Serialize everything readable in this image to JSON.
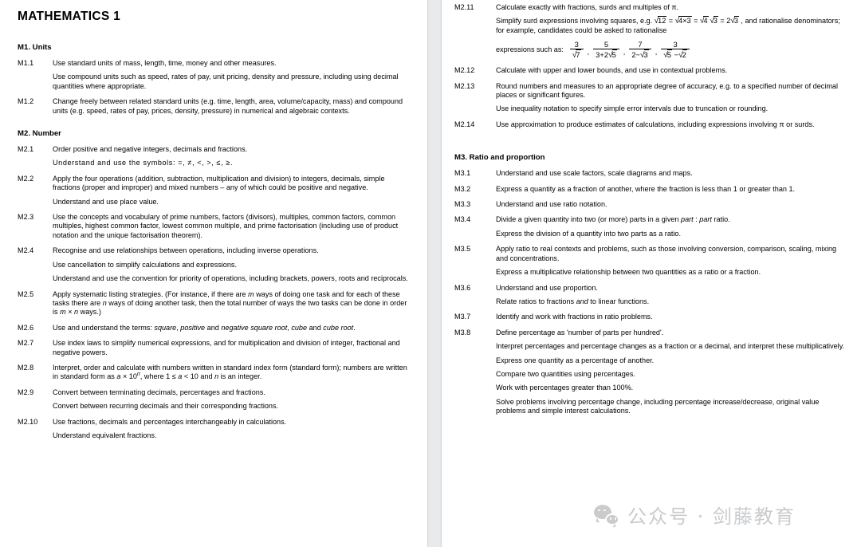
{
  "document": {
    "title": "MATHEMATICS 1"
  },
  "watermark": {
    "icon": "wechat-icon",
    "text": "公众号 · 剑藤教育"
  },
  "left_column": {
    "sections": [
      {
        "heading": "M1. Units",
        "items": [
          {
            "code": "M1.1",
            "paragraphs": [
              "Use standard units of mass, length, time, money and other measures.",
              "Use compound units such as speed, rates of pay, unit pricing, density and pressure, including using decimal quantities where appropriate."
            ]
          },
          {
            "code": "M1.2",
            "paragraphs": [
              "Change freely between related standard units (e.g. time, length, area, volume/capacity, mass) and compound units (e.g. speed, rates of pay, prices, density, pressure) in numerical and algebraic contexts."
            ]
          }
        ]
      },
      {
        "heading": "M2. Number",
        "items": [
          {
            "code": "M2.1",
            "paragraphs": [
              "Order positive and negative integers, decimals and fractions.",
              "Understand and use the symbols: =, ≠, <, >, ≤, ≥."
            ]
          },
          {
            "code": "M2.2",
            "paragraphs": [
              "Apply the four operations (addition, subtraction, multiplication and division) to integers, decimals, simple fractions (proper and improper) and mixed numbers – any of which could be positive and negative.",
              "Understand and use place value."
            ]
          },
          {
            "code": "M2.3",
            "paragraphs": [
              "Use the concepts and vocabulary of prime numbers, factors (divisors), multiples, common factors, common multiples, highest common factor, lowest common multiple, and prime factorisation (including use of product notation and the unique factorisation theorem)."
            ]
          },
          {
            "code": "M2.4",
            "paragraphs": [
              "Recognise and use relationships between operations, including inverse operations.",
              "Use cancellation to simplify calculations and expressions.",
              "Understand and use the convention for priority of operations, including brackets, powers, roots and reciprocals."
            ]
          },
          {
            "code": "M2.5",
            "paragraphs": [
              "Apply systematic listing strategies. (For instance, if there are m ways of doing one task and for each of these tasks there are n ways of doing another task, then the total number of ways the two tasks can be done in order is m × n ways.)"
            ]
          },
          {
            "code": "M2.6",
            "paragraphs": [
              "Use and understand the terms: square, positive and negative square root, cube and cube root."
            ]
          },
          {
            "code": "M2.7",
            "paragraphs": [
              "Use index laws to simplify numerical expressions, and for multiplication and division of integer, fractional and negative powers."
            ]
          },
          {
            "code": "M2.8",
            "paragraphs": [
              "Interpret, order and calculate with numbers written in standard index form (standard form); numbers are written in standard form as a × 10n, where 1 ≤ a < 10 and n is an integer."
            ]
          },
          {
            "code": "M2.9",
            "paragraphs": [
              "Convert between terminating decimals, percentages and fractions.",
              "Convert between recurring decimals and their corresponding fractions."
            ]
          },
          {
            "code": "M2.10",
            "paragraphs": [
              "Use fractions, decimals and percentages interchangeably in calculations.",
              "Understand equivalent fractions."
            ]
          }
        ]
      }
    ]
  },
  "right_column": {
    "items_continued": [
      {
        "code": "M2.11",
        "paragraphs": [
          "Calculate exactly with fractions, surds and multiples of π.",
          "Simplify surd expressions involving squares, e.g. √12 = √(4×3) = √4 √3 = 2√3 , and rationalise denominators; for example, candidates could be asked to rationalise"
        ],
        "math": {
          "lead": "expressions such as:",
          "expressions": [
            {
              "num": "3",
              "den": "√7"
            },
            {
              "num": "5",
              "den": "3+2√5"
            },
            {
              "num": "7",
              "den": "2−√3"
            },
            {
              "num": "3",
              "den": "√5 −√2"
            }
          ]
        }
      },
      {
        "code": "M2.12",
        "paragraphs": [
          "Calculate with upper and lower bounds, and use in contextual problems."
        ]
      },
      {
        "code": "M2.13",
        "paragraphs": [
          "Round numbers and measures to an appropriate degree of accuracy, e.g. to a specified number of decimal places or significant figures.",
          "Use inequality notation to specify simple error intervals due to truncation or rounding."
        ]
      },
      {
        "code": "M2.14",
        "paragraphs": [
          "Use approximation to produce estimates of calculations, including expressions involving π or surds."
        ]
      }
    ],
    "sections": [
      {
        "heading": "M3. Ratio and proportion",
        "items": [
          {
            "code": "M3.1",
            "paragraphs": [
              "Understand and use scale factors, scale diagrams and maps."
            ]
          },
          {
            "code": "M3.2",
            "paragraphs": [
              "Express a quantity as a fraction of another, where the fraction is less than 1 or greater than 1."
            ]
          },
          {
            "code": "M3.3",
            "paragraphs": [
              "Understand and use ratio notation."
            ]
          },
          {
            "code": "M3.4",
            "paragraphs": [
              "Divide a given quantity into two (or more) parts in a given part : part ratio.",
              "Express the division of a quantity into two parts as a ratio."
            ]
          },
          {
            "code": "M3.5",
            "paragraphs": [
              "Apply ratio to real contexts and problems, such as those involving conversion, comparison, scaling, mixing and concentrations.",
              "Express a multiplicative relationship between two quantities as a ratio or a fraction."
            ]
          },
          {
            "code": "M3.6",
            "paragraphs": [
              "Understand and use proportion.",
              "Relate ratios to fractions and to linear functions."
            ]
          },
          {
            "code": "M3.7",
            "paragraphs": [
              "Identify and work with fractions in ratio problems."
            ]
          },
          {
            "code": "M3.8",
            "paragraphs": [
              "Define percentage as 'number of parts per hundred'.",
              "Interpret percentages and percentage changes as a fraction or a decimal, and interpret these multiplicatively.",
              "Express one quantity as a percentage of another.",
              "Compare two quantities using percentages.",
              "Work with percentages greater than 100%.",
              "Solve problems involving percentage change, including percentage increase/decrease, original value problems and simple interest calculations."
            ]
          }
        ]
      }
    ]
  }
}
